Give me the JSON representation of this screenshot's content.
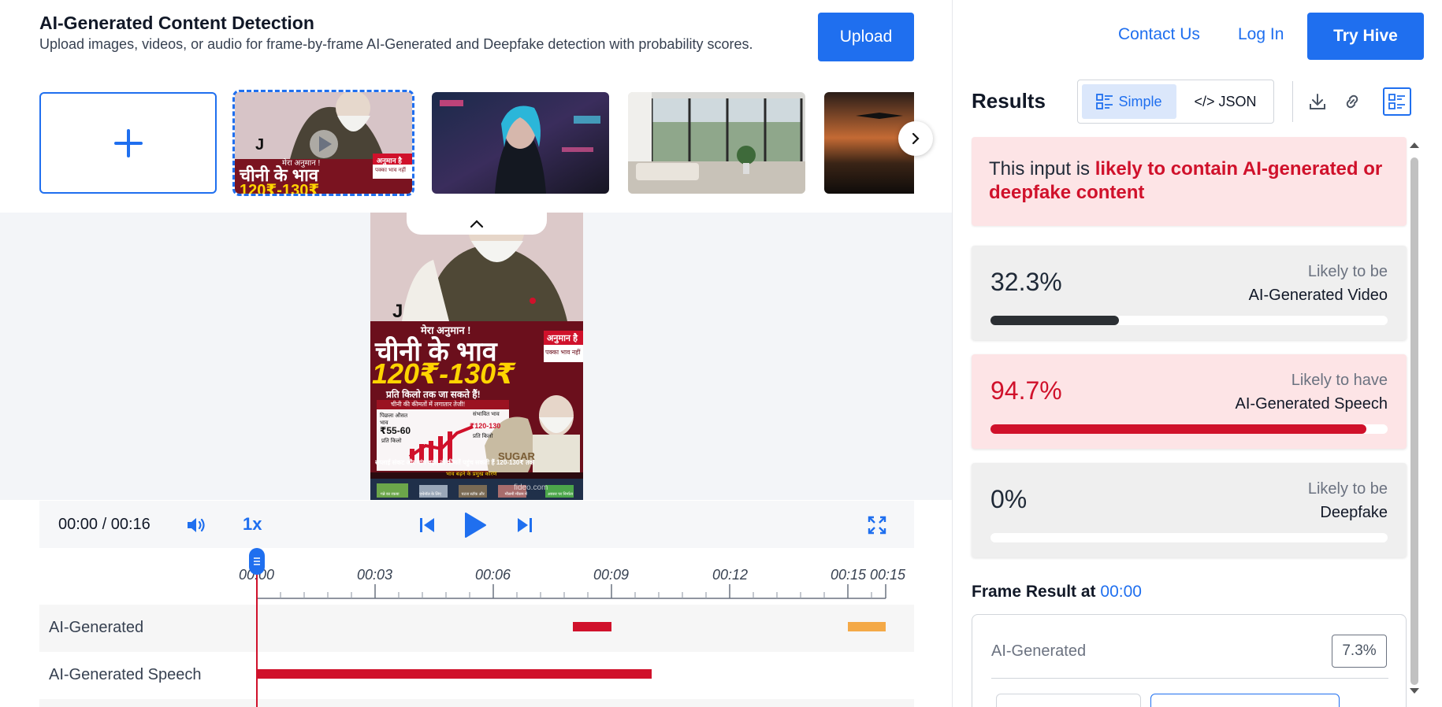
{
  "header": {
    "title": "AI-Generated Content Detection",
    "subtitle": "Upload images, videos, or audio for frame-by-frame AI-Generated and Deepfake detection with probability scores.",
    "upload_label": "Upload"
  },
  "thumbnails": {
    "video_thumb_text": {
      "line1": "मेरा अनुमान !",
      "line2": "चीनी के भाव",
      "line3": "120₹-130₹",
      "badge1": "अनुमान है",
      "badge2": "पक्का भाव नहीं",
      "mark": "J"
    }
  },
  "video": {
    "mark": "J",
    "kicker": "मेरा अनुमान !",
    "headline": "चीनी के भाव",
    "price": "120₹-130₹",
    "sub": "प्रति किलो तक जा सकते हैं!",
    "badge1": "अनुमान है",
    "badge2": "पक्का भाव नहीं",
    "chart_caption": "चीनी की कीमतों में लगातार तेजी!",
    "old_label": "पिछला औसत भाव",
    "old_price": "₹55-60",
    "old_unit": "प्रति किलो",
    "new_label": "संभावित भाव",
    "new_price": "₹120-130",
    "new_unit": "प्रति किलो",
    "sack_text": "SUGAR",
    "warning": "सप्लाई संकट और मांग बढ़ी, तो कीमतें पहुंच सकती हैं 120-130₹ तक",
    "reasons_title": "भाव बढ़ने के प्रमुख कारण",
    "reasons": [
      "गन्ने का रकबा",
      "एथेनॉल के लिए",
      "घटता स्टॉक और",
      "मौसमी मौसम में",
      "अवसर पर निर्माता"
    ],
    "watermark": "fideo.com"
  },
  "player": {
    "time": "00:00 / 00:16",
    "speed": "1x"
  },
  "timeline": {
    "ticks": [
      "00:00",
      "00:03",
      "00:06",
      "00:09",
      "00:12",
      "00:15",
      "00:15"
    ],
    "tracks": [
      {
        "label": "AI-Generated"
      },
      {
        "label": "AI-Generated Speech"
      }
    ]
  },
  "nav": {
    "contact": "Contact Us",
    "login": "Log In",
    "try": "Try Hive"
  },
  "results": {
    "title": "Results",
    "view_simple": "Simple",
    "view_json": "</> JSON",
    "banner_prefix": "This input is ",
    "banner_highlight": "likely to contain AI-generated or deepfake content",
    "cards": [
      {
        "pct": "32.3%",
        "cap1": "Likely to be",
        "cap2": "AI-Generated Video",
        "fraction": 0.323
      },
      {
        "pct": "94.7%",
        "cap1": "Likely to have",
        "cap2": "AI-Generated Speech",
        "fraction": 0.947
      },
      {
        "pct": "0%",
        "cap1": "Likely to be",
        "cap2": "Deepfake",
        "fraction": 0.0
      }
    ],
    "frame_label": "Frame Result at ",
    "frame_time": "00:00",
    "frame_row_label": "AI-Generated",
    "frame_row_value": "7.3%"
  },
  "colors": {
    "accent": "#1f6fef",
    "danger": "#d0112b",
    "bar_dark": "#2b2f33",
    "orange": "#f4a947"
  }
}
